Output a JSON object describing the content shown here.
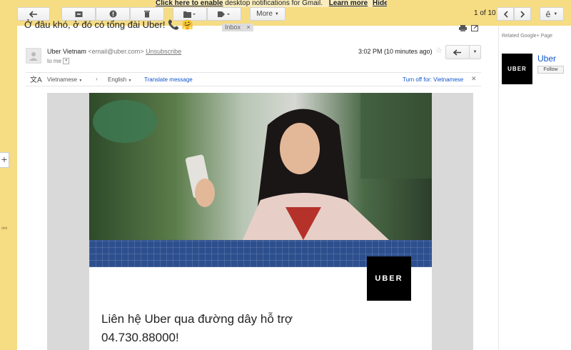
{
  "notification": {
    "link_text": "Click here to enable",
    "rest_text": " desktop notifications for Gmail.",
    "learn_more": "Learn more",
    "hide": "Hide"
  },
  "toolbar": {
    "more_label": "More",
    "pager": "1 of 10",
    "input_tool": "ê"
  },
  "email": {
    "subject": "Ở đâu khó, ở đó có tổng đài Uber!",
    "subject_emoji": "📞 🤗",
    "label_chip": "Inbox",
    "label_chip_close": "×",
    "sender_name": "Uber Vietnam",
    "sender_email": "<email@uber.com>",
    "unsubscribe": "Unsubscribe",
    "to_me": "to me",
    "time": "3:02 PM (10 minutes ago)",
    "translate": {
      "from_lang": "Vietnamese",
      "to_lang": "English",
      "translate_link": "Translate message",
      "turn_off": "Turn off for: Vietnamese"
    },
    "body": {
      "logo_text": "UBER",
      "headline": "Liên hệ Uber qua đường dây hỗ trợ 04.730.88000!"
    }
  },
  "sidebar": {
    "related_title": "Related Google+ Page",
    "page_logo_text": "UBER",
    "page_name": "Uber",
    "follow": "Follow"
  },
  "icons": {
    "back": "back-arrow-icon",
    "archive": "archive-icon",
    "spam": "report-spam-icon",
    "delete": "trash-icon",
    "move": "folder-icon",
    "labels": "label-tag-icon",
    "prev": "chevron-left-icon",
    "next": "chevron-right-icon",
    "print": "print-icon",
    "popout": "new-window-icon",
    "reply": "reply-icon",
    "star": "star-icon",
    "translate": "translate-icon"
  }
}
